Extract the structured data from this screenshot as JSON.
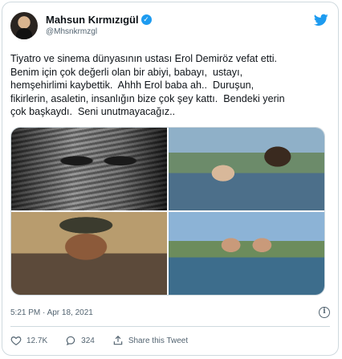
{
  "author": {
    "display_name": "Mahsun Kırmızıgül",
    "handle": "@Mhsnkrmzgl",
    "verified": true,
    "avatar_icon": "profile-photo"
  },
  "platform_icon": "twitter-bird-icon",
  "tweet": {
    "text": "Tiyatro ve sinema dünyasının ustası Erol Demiröz vefat etti.\nBenim için çok değerli olan bir abiyi, babayı,  ustayı,\nhemşehirlimi kaybettik.  Ahhh Erol baba ah..  Duruşun,\nfikirlerin, asaletin, insanlığın bize çok şey kattı.  Bendeki yerin\nçok başkaydı.  Seni unutmayacağız..",
    "media_count": 4
  },
  "meta": {
    "timestamp": "5:21 PM · Apr 18, 2021"
  },
  "actions": {
    "likes": "12.7K",
    "replies": "324",
    "share_label": "Share this Tweet"
  },
  "colors": {
    "accent": "#1d9bf0",
    "text": "#0f1419",
    "secondary_text": "#536471",
    "border": "#cfd9de"
  }
}
